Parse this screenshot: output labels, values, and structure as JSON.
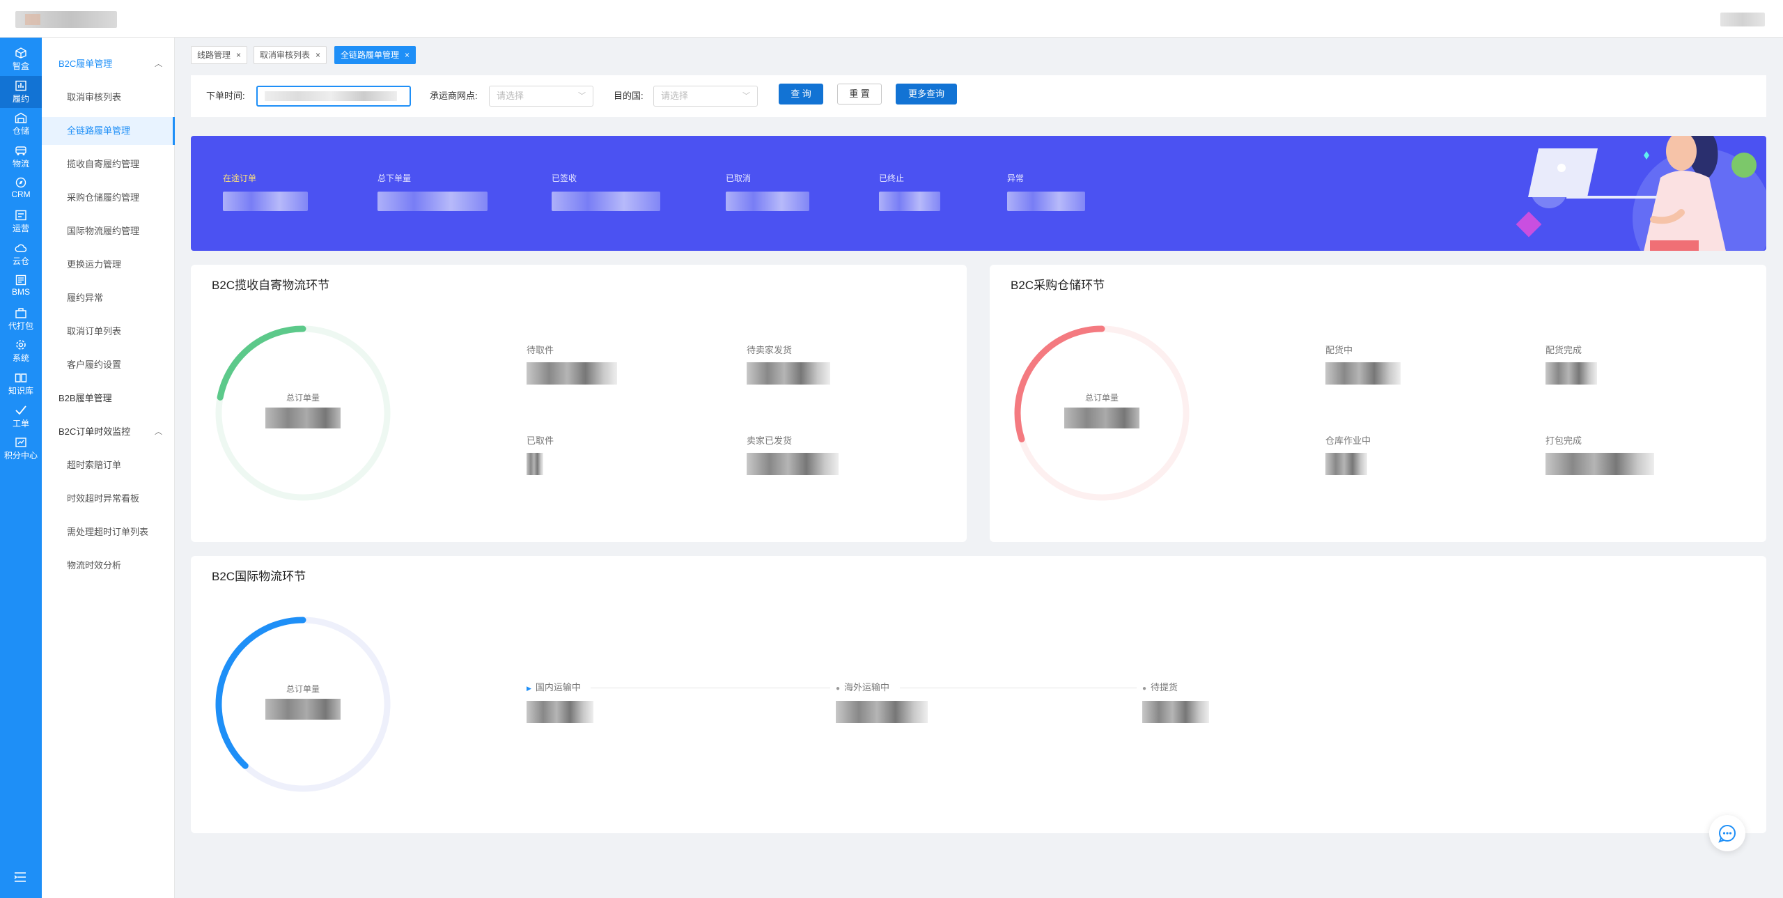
{
  "topbar": {
    "logo_name": "logo-icon"
  },
  "rail": {
    "items": [
      {
        "label": "智盒",
        "icon": "cube-icon"
      },
      {
        "label": "履约",
        "icon": "chart-icon",
        "active": true
      },
      {
        "label": "仓储",
        "icon": "warehouse-icon"
      },
      {
        "label": "物流",
        "icon": "truck-icon"
      },
      {
        "label": "CRM",
        "icon": "compass-icon"
      },
      {
        "label": "运营",
        "icon": "monitor-icon"
      },
      {
        "label": "云仓",
        "icon": "cloud-icon"
      },
      {
        "label": "BMS",
        "icon": "bms-icon"
      },
      {
        "label": "代打包",
        "icon": "package-icon"
      },
      {
        "label": "系统",
        "icon": "gear-icon"
      },
      {
        "label": "知识库",
        "icon": "book-icon"
      },
      {
        "label": "工单",
        "icon": "check-icon"
      },
      {
        "label": "积分中心",
        "icon": "points-icon"
      }
    ]
  },
  "subnav": {
    "items": [
      {
        "label": "B2C履单管理",
        "type": "group",
        "expanded": true,
        "blue": true
      },
      {
        "label": "取消审核列表",
        "type": "child"
      },
      {
        "label": "全链路履单管理",
        "type": "child",
        "active": true
      },
      {
        "label": "揽收自寄履约管理",
        "type": "child"
      },
      {
        "label": "采购仓储履约管理",
        "type": "child"
      },
      {
        "label": "国际物流履约管理",
        "type": "child"
      },
      {
        "label": "更换运力管理",
        "type": "child"
      },
      {
        "label": "履约异常",
        "type": "child"
      },
      {
        "label": "取消订单列表",
        "type": "child"
      },
      {
        "label": "客户履约设置",
        "type": "child"
      },
      {
        "label": "B2B履单管理",
        "type": "group"
      },
      {
        "label": "B2C订单时效监控",
        "type": "group",
        "expanded": true
      },
      {
        "label": "超时索赔订单",
        "type": "child"
      },
      {
        "label": "时效超时异常看板",
        "type": "child"
      },
      {
        "label": "需处理超时订单列表",
        "type": "child"
      },
      {
        "label": "物流时效分析",
        "type": "child"
      }
    ]
  },
  "tabs": [
    {
      "label": "线路管理",
      "close": "×"
    },
    {
      "label": "取消审核列表",
      "close": "×"
    },
    {
      "label": "全链路履单管理",
      "close": "×",
      "active": true
    }
  ],
  "filter": {
    "order_time_label": "下单时间:",
    "carrier_label": "承运商网点:",
    "carrier_placeholder": "请选择",
    "dest_label": "目的国:",
    "dest_placeholder": "请选择",
    "query_btn": "查 询",
    "reset_btn": "重 置",
    "more_btn": "更多查询"
  },
  "banner": {
    "stats": [
      {
        "label": "在途订单",
        "highlight": true
      },
      {
        "label": "总下单量"
      },
      {
        "label": "已签收"
      },
      {
        "label": "已取消"
      },
      {
        "label": "已终止"
      },
      {
        "label": "异常"
      }
    ]
  },
  "cards": {
    "pickup": {
      "title": "B2C揽收自寄物流环节",
      "ring_label": "总订单量",
      "ring_color": "#5cc98a",
      "ring_track": "#eef8f2",
      "ring_fraction": 0.22,
      "metrics": [
        "待取件",
        "待卖家发货",
        "已取件",
        "卖家已发货"
      ]
    },
    "warehouse": {
      "title": "B2C采购仓储环节",
      "ring_label": "总订单量",
      "ring_color": "#f47a80",
      "ring_track": "#fdf0f0",
      "ring_fraction": 0.3,
      "metrics": [
        "配货中",
        "配货完成",
        "仓库作业中",
        "打包完成"
      ]
    },
    "intl": {
      "title": "B2C国际物流环节",
      "ring_label": "总订单量",
      "ring_color": "#1e8ff7",
      "ring_track": "#eef0fb",
      "ring_fraction": 0.38,
      "flow": [
        "国内运输中",
        "海外运输中",
        "待提货"
      ]
    }
  },
  "colors": {
    "primary": "#1e8ff7",
    "banner": "#4b52f2"
  }
}
